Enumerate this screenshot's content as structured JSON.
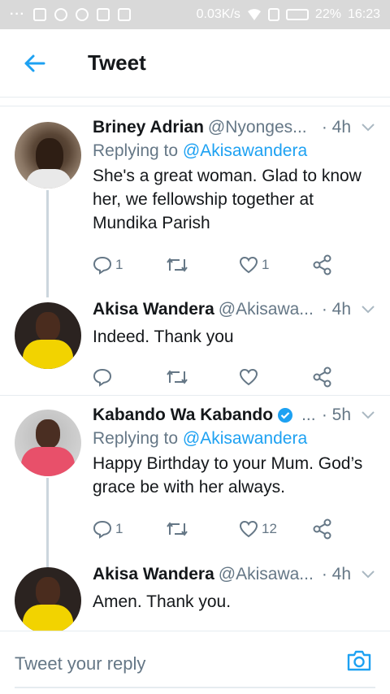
{
  "status_bar": {
    "network": "0.03K/s",
    "battery": "22%",
    "time": "16:23"
  },
  "header": {
    "title": "Tweet"
  },
  "tweets": [
    {
      "name": "Briney Adrian",
      "handle": "@Nyonges...",
      "time": "· 4h",
      "replying_prefix": "Replying to",
      "replying_to": "@Akisawandera",
      "text": "She's a great woman. Glad to know her, we fellowship together at Mundika Parish",
      "reply_count": "1",
      "like_count": "1"
    },
    {
      "name": "Akisa Wandera",
      "handle": "@Akisawa...",
      "time": "· 4h",
      "text": "Indeed. Thank you"
    },
    {
      "name": "Kabando Wa Kabando",
      "handle": "...",
      "time": "· 5h",
      "replying_prefix": "Replying to",
      "replying_to": "@Akisawandera",
      "text": "Happy Birthday to your Mum. God’s grace be with her always.",
      "reply_count": "1",
      "like_count": "12"
    },
    {
      "name": "Akisa Wandera",
      "handle": "@Akisawa...",
      "time": "· 4h",
      "text": "Amen. Thank you."
    }
  ],
  "composer": {
    "placeholder": "Tweet your reply"
  },
  "colors": {
    "accent": "#1da1f2",
    "muted": "#657786",
    "verified": "#1da1f2"
  },
  "icons": [
    "back-arrow-icon",
    "reply-icon",
    "retweet-icon",
    "heart-icon",
    "share-icon",
    "chevron-down-icon",
    "verified-badge-icon",
    "camera-icon"
  ]
}
